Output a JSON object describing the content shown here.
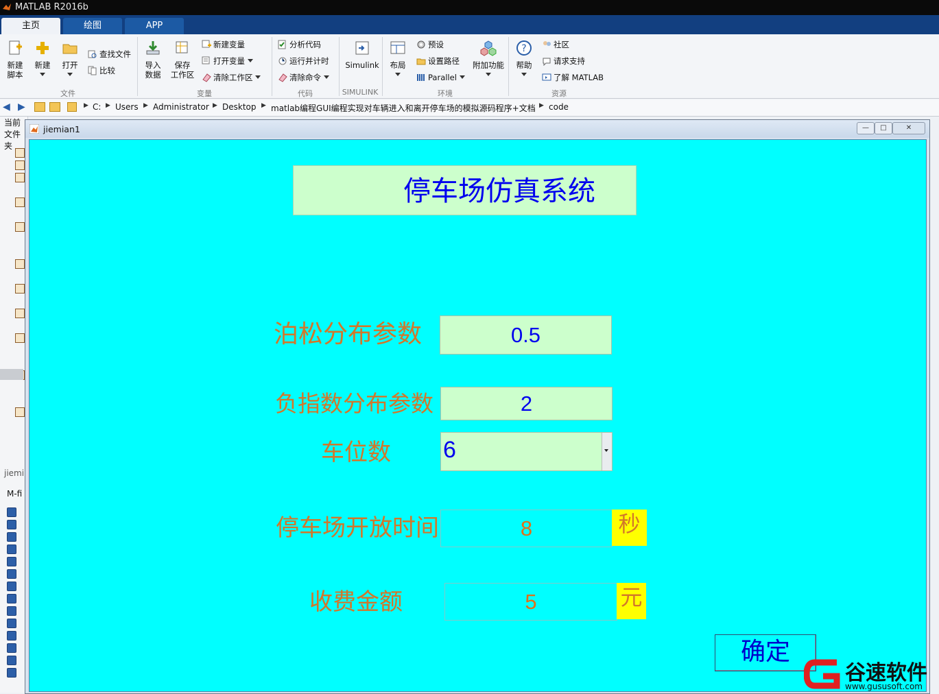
{
  "app": {
    "title": "MATLAB R2016b"
  },
  "tabs": [
    "主页",
    "绘图",
    "APP"
  ],
  "ribbon": {
    "file": {
      "new_script": "新建\n脚本",
      "new": "新建",
      "open": "打开",
      "find_files": "查找文件",
      "compare": "比较",
      "group": "文件"
    },
    "variable": {
      "import": "导入\n数据",
      "save_ws": "保存\n工作区",
      "new_var": "新建变量",
      "open_var": "打开变量",
      "clear_ws": "清除工作区",
      "group": "变量"
    },
    "code": {
      "analyze": "分析代码",
      "run_time": "运行并计时",
      "clear_cmd": "清除命令",
      "group": "代码"
    },
    "simulink": {
      "label": "Simulink",
      "group": "SIMULINK"
    },
    "env": {
      "layout": "布局",
      "prefs": "预设",
      "set_path": "设置路径",
      "parallel": "Parallel",
      "addons": "附加功能",
      "group": "环境"
    },
    "resources": {
      "help": "帮助",
      "community": "社区",
      "support": "请求支持",
      "learn": "了解 MATLAB",
      "group": "资源"
    }
  },
  "address": {
    "crumbs": [
      "C:",
      "Users",
      "Administrator",
      "Desktop",
      "matlab编程GUI编程实现对车辆进入和离开停车场的模拟源码程序+文档",
      "code"
    ]
  },
  "side": {
    "current_folder": "当前文件夹",
    "file_label": "jiemi",
    "mfile_label": "M-fi"
  },
  "figure": {
    "window_title": "jiemian1",
    "heading": "停车场仿真系统",
    "fields": {
      "poisson_label": "泊松分布参数",
      "poisson_value": "0.5",
      "exp_label": "负指数分布参数",
      "exp_value": "2",
      "spaces_label": "车位数",
      "spaces_value": "6",
      "open_time_label": "停车场开放时间",
      "open_time_value": "8",
      "open_time_unit": "秒",
      "fee_label": "收费金额",
      "fee_value": "5",
      "fee_unit": "元"
    },
    "ok_button": "确定"
  },
  "watermark": {
    "brand": "谷速软件",
    "url": "www.gususoft.com"
  },
  "colors": {
    "canvas": "#00ffff",
    "field_bg": "#ccffcc",
    "label": "#d2772a",
    "value_blue": "#0000ee",
    "unit_bg": "#ffff00"
  }
}
